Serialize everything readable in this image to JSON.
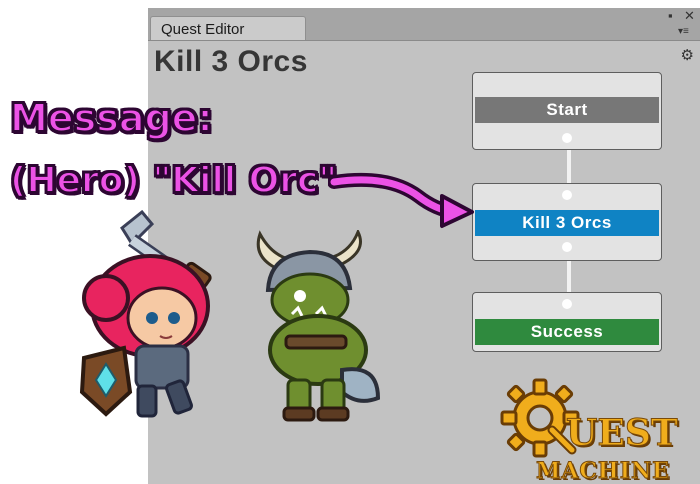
{
  "window": {
    "tab_label": "Quest Editor",
    "maximize_glyph": "▪",
    "close_glyph": "✕",
    "menu_glyph": "▾≡",
    "gear_glyph": "⚙"
  },
  "quest": {
    "title": "Kill 3 Orcs"
  },
  "nodes": [
    {
      "label": "Start",
      "color": "#777777"
    },
    {
      "label": "Kill 3 Orcs",
      "color": "#0f83c4"
    },
    {
      "label": "Success",
      "color": "#2f8a3e"
    }
  ],
  "overlay": {
    "message_line1": "Message:",
    "message_line2": "(Hero) \"Kill Orc\"",
    "accent_color": "#ec52e6"
  },
  "logo": {
    "quest_rest": "UEST",
    "machine": "MACHINE"
  },
  "icons": [
    "hero-icon",
    "orc-icon",
    "gear-icon",
    "arrow-icon",
    "close-icon",
    "menu-icon"
  ]
}
